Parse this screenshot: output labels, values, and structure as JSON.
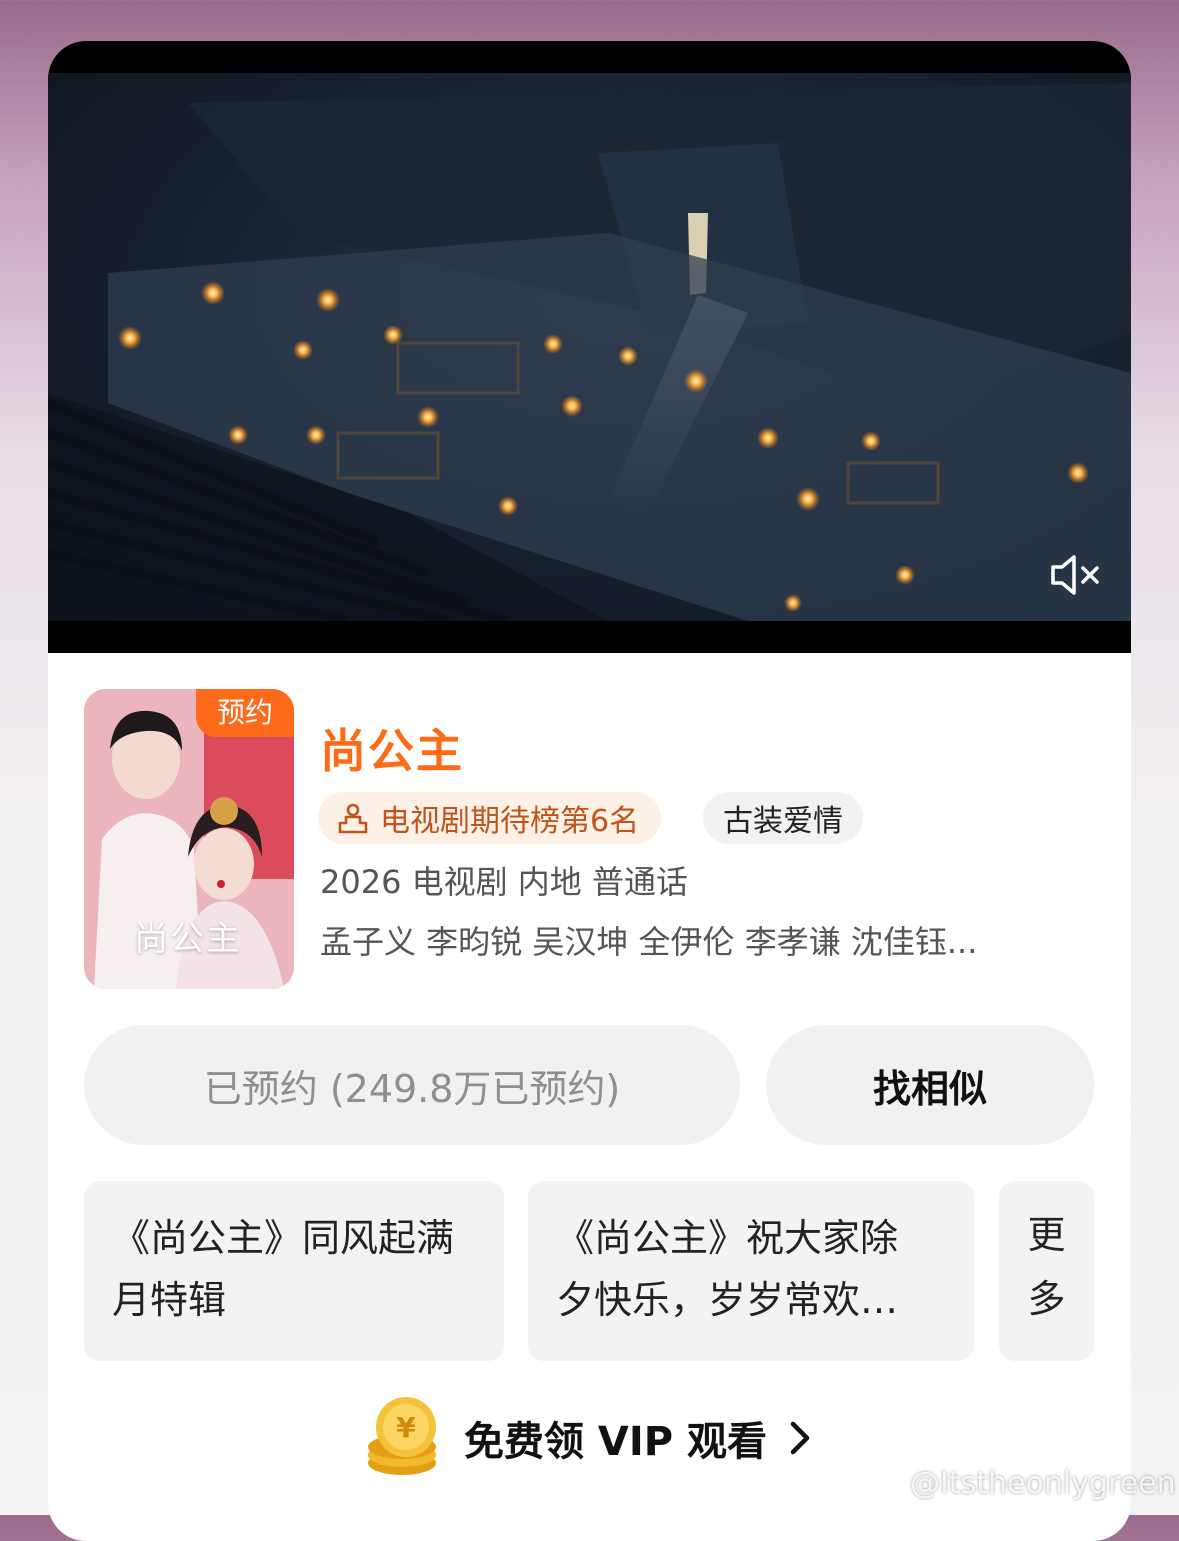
{
  "video": {
    "mute_icon": "speaker-muted-icon"
  },
  "drama": {
    "poster_badge": "预约",
    "poster_title": "尚公主",
    "title": "尚公主",
    "rank_icon": "podium-icon",
    "rank": "电视剧期待榜第6名",
    "genre": "古装爱情",
    "meta": "2026 电视剧 内地 普通话",
    "cast": "孟子义 李昀锐 吴汉坤 全伊伦 李孝谦 沈佳钰..."
  },
  "buttons": {
    "reserved": "已预约 (249.8万已预约)",
    "similar": "找相似"
  },
  "clips": [
    {
      "line1": "《尚公主》同风起满",
      "line2": "月特辑"
    },
    {
      "line1": "《尚公主》祝大家除",
      "line2": "夕快乐，岁岁常欢…"
    }
  ],
  "more": {
    "line1": "更",
    "line2": "多"
  },
  "vip": {
    "label": "免费领 VIP 观看",
    "coin_icon": "gold-coin-icon",
    "arrow_icon": "chevron-right-icon"
  },
  "watermark": "@Itstheonlygreen",
  "colors": {
    "accent": "#ff6a14",
    "badge": "#ff6a1a"
  }
}
